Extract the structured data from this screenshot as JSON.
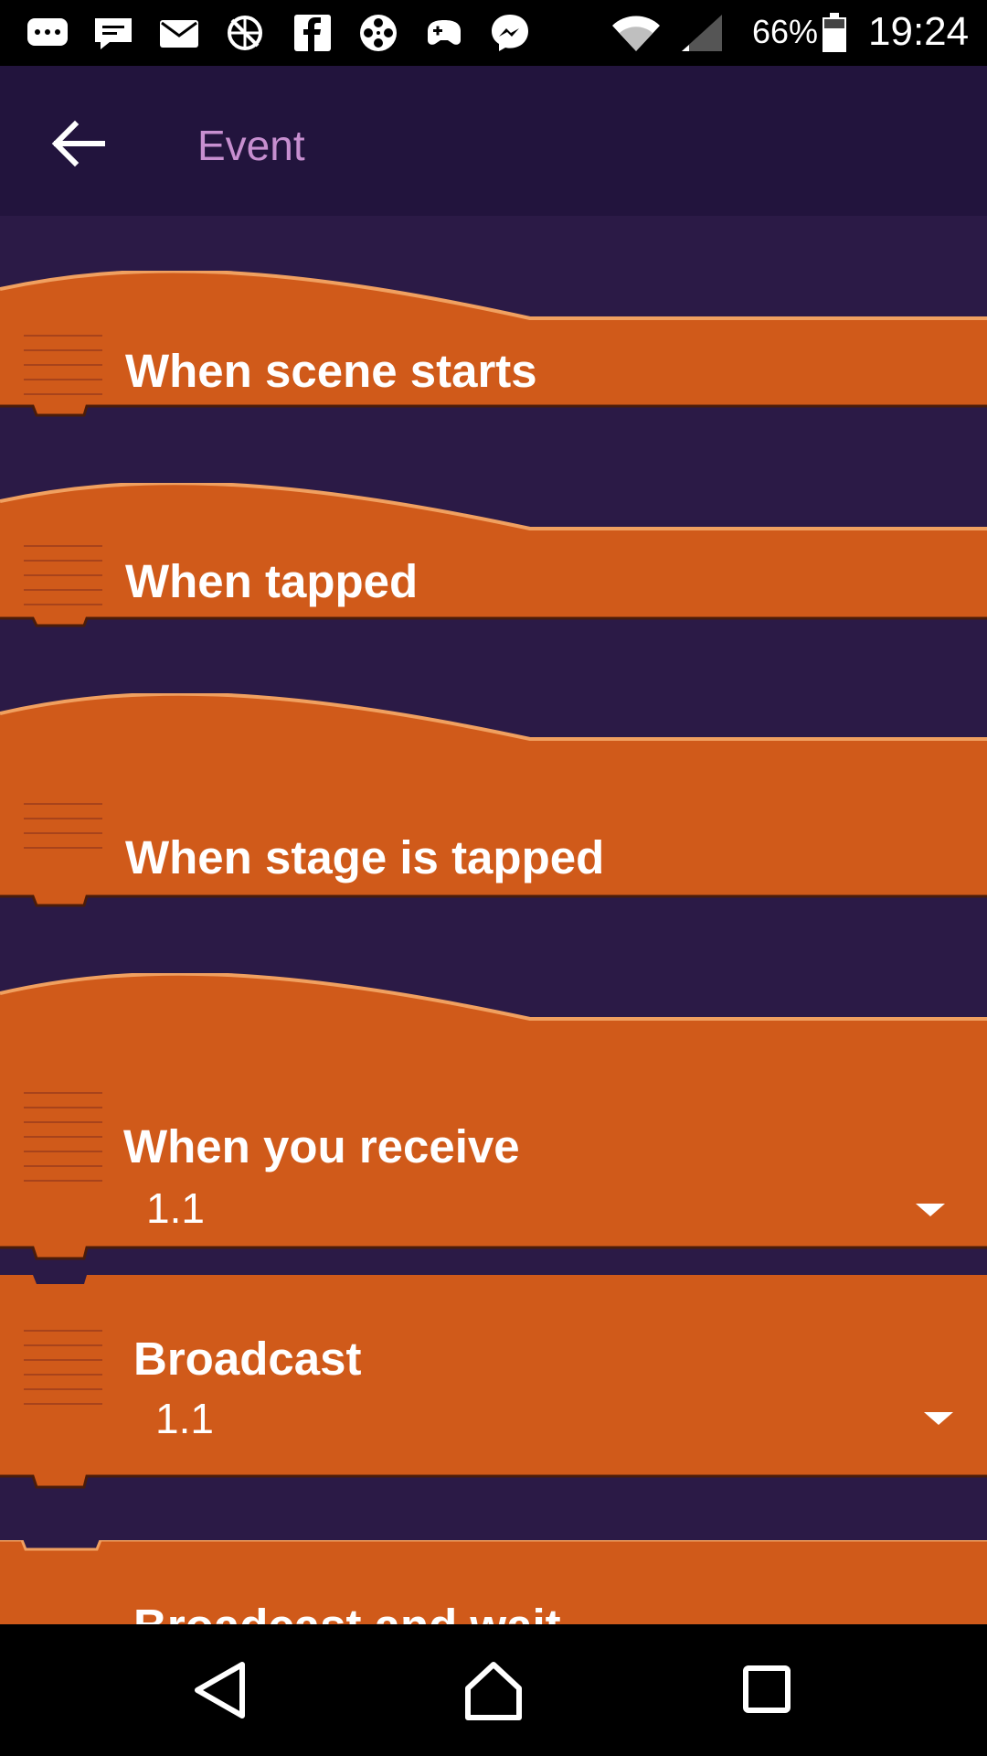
{
  "status_bar": {
    "icons": [
      "chat-bubble-icon",
      "message-icon",
      "mail-icon",
      "no-data-icon",
      "facebook-icon",
      "film-reel-icon",
      "game-controller-icon",
      "messenger-icon",
      "wifi-icon",
      "signal-icon",
      "battery-icon"
    ],
    "battery_percent": "66%",
    "time": "19:24"
  },
  "app_bar": {
    "title": "Event"
  },
  "bricks": [
    {
      "label": "When scene starts"
    },
    {
      "label": "When tapped"
    },
    {
      "label": "When stage is tapped"
    },
    {
      "label": "When you receive",
      "value": "1.1"
    },
    {
      "label": "Broadcast",
      "value": "1.1"
    },
    {
      "label": "Broadcast and wait"
    }
  ],
  "colors": {
    "brick_orange": "#d05a1a",
    "brick_edge": "#f0a060",
    "background": "#2b1a46",
    "app_bar": "#22143d",
    "title": "#c78fd0"
  },
  "nav_bar": {
    "icons": [
      "back-triangle-icon",
      "home-icon",
      "recents-square-icon"
    ]
  }
}
